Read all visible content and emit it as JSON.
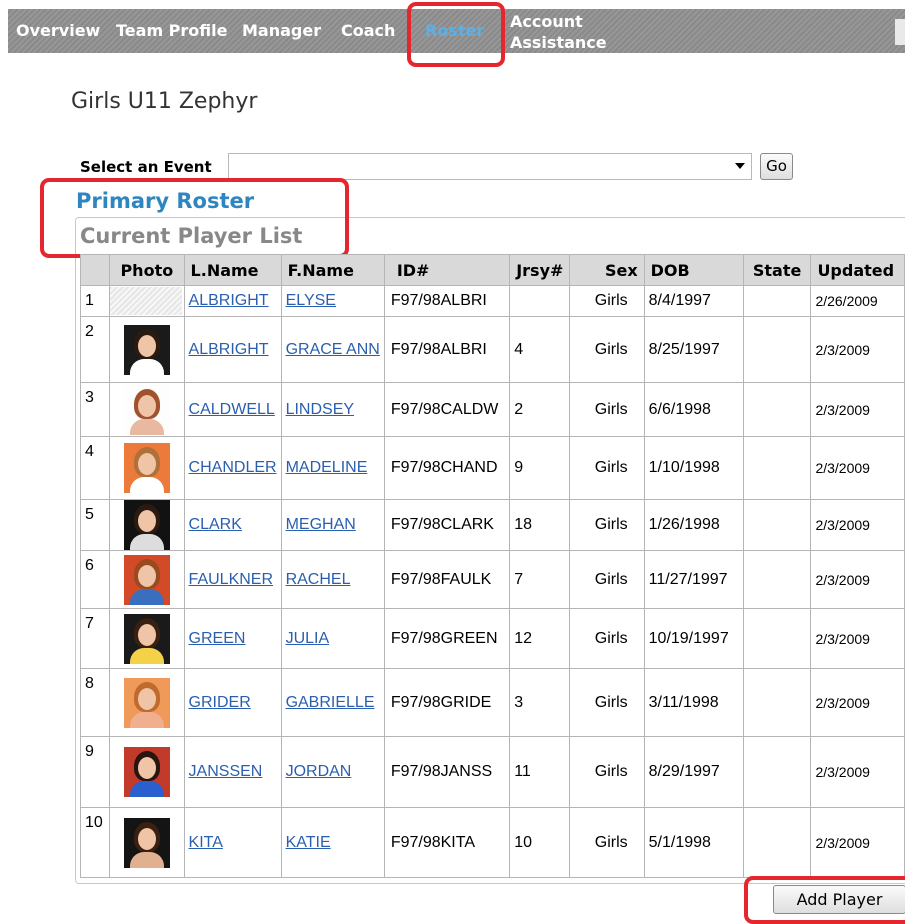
{
  "nav": {
    "items": [
      {
        "label": "Overview"
      },
      {
        "label": "Team Profile"
      },
      {
        "label": "Manager"
      },
      {
        "label": "Coach"
      },
      {
        "label": "Roster",
        "active": true
      },
      {
        "label_line1": "Account",
        "label_line2": "Assistance"
      }
    ]
  },
  "team_name": "Girls U11 Zephyr",
  "event": {
    "label": "Select an Event",
    "selected": "",
    "go_label": "Go"
  },
  "primary_roster_title": "Primary Roster",
  "current_list_title": "Current Player List",
  "table": {
    "headers": [
      "",
      "Photo",
      "L.Name",
      "F.Name",
      "ID#",
      "Jrsy#",
      "Sex",
      "DOB",
      "State",
      "Updated"
    ],
    "rows": [
      {
        "num": "1",
        "lname": "ALBRIGHT",
        "fname": "ELYSE",
        "id": "F97/98ALBRI",
        "jersey": "",
        "sex": "Girls",
        "dob": "8/4/1997",
        "state": "",
        "updated": "2/26/2009",
        "photo": "none"
      },
      {
        "num": "2",
        "lname": "ALBRIGHT",
        "fname": "GRACE ANN",
        "id": "F97/98ALBRI",
        "jersey": "4",
        "sex": "Girls",
        "dob": "8/25/1997",
        "state": "",
        "updated": "2/3/2009",
        "photo": "photo"
      },
      {
        "num": "3",
        "lname": "CALDWELL",
        "fname": "LINDSEY",
        "id": "F97/98CALDW",
        "jersey": "2",
        "sex": "Girls",
        "dob": "6/6/1998",
        "state": "",
        "updated": "2/3/2009",
        "photo": "photo"
      },
      {
        "num": "4",
        "lname": "CHANDLER",
        "fname": "MADELINE",
        "id": "F97/98CHAND",
        "jersey": "9",
        "sex": "Girls",
        "dob": "1/10/1998",
        "state": "",
        "updated": "2/3/2009",
        "photo": "photo"
      },
      {
        "num": "5",
        "lname": "CLARK",
        "fname": "MEGHAN",
        "id": "F97/98CLARK",
        "jersey": "18",
        "sex": "Girls",
        "dob": "1/26/1998",
        "state": "",
        "updated": "2/3/2009",
        "photo": "photo"
      },
      {
        "num": "6",
        "lname": "FAULKNER",
        "fname": "RACHEL",
        "id": "F97/98FAULK",
        "jersey": "7",
        "sex": "Girls",
        "dob": "11/27/1997",
        "state": "",
        "updated": "2/3/2009",
        "photo": "photo"
      },
      {
        "num": "7",
        "lname": "GREEN",
        "fname": "JULIA",
        "id": "F97/98GREEN",
        "jersey": "12",
        "sex": "Girls",
        "dob": "10/19/1997",
        "state": "",
        "updated": "2/3/2009",
        "photo": "photo"
      },
      {
        "num": "8",
        "lname": "GRIDER",
        "fname": "GABRIELLE",
        "id": "F97/98GRIDE",
        "jersey": "3",
        "sex": "Girls",
        "dob": "3/11/1998",
        "state": "",
        "updated": "2/3/2009",
        "photo": "photo"
      },
      {
        "num": "9",
        "lname": "JANSSEN",
        "fname": "JORDAN",
        "id": "F97/98JANSS",
        "jersey": "11",
        "sex": "Girls",
        "dob": "8/29/1997",
        "state": "",
        "updated": "2/3/2009",
        "photo": "photo"
      },
      {
        "num": "10",
        "lname": "KITA",
        "fname": "KATIE",
        "id": "F97/98KITA",
        "jersey": "10",
        "sex": "Girls",
        "dob": "5/1/1998",
        "state": "",
        "updated": "2/3/2009",
        "photo": "photo"
      }
    ]
  },
  "add_player_label": "Add Player",
  "colors": {
    "nav_bg": "#8f8f8f",
    "nav_active": "#5cb0e6",
    "link": "#2a5fb0",
    "primary_title": "#2e86c1",
    "highlight": "#e6262e",
    "header_bg": "#d9d9d9"
  }
}
